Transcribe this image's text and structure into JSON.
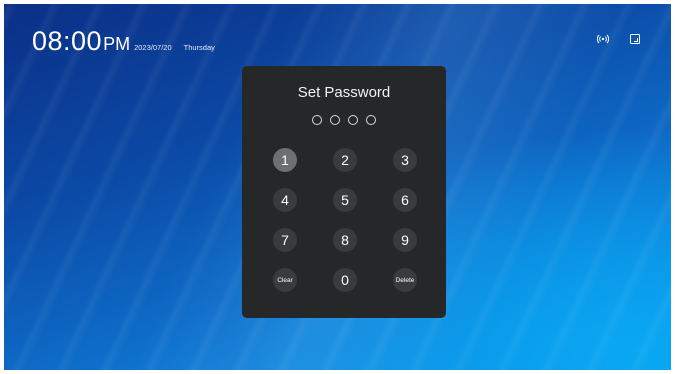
{
  "status_bar": {
    "time": "08:00",
    "ampm": "PM",
    "date": "2023/07/20",
    "day": "Thursday",
    "icons": [
      "signal-icon",
      "input-source-icon"
    ]
  },
  "dialog": {
    "title": "Set Password",
    "pin_length": 4,
    "keys": [
      {
        "label": "1",
        "selected": true
      },
      {
        "label": "2",
        "selected": false
      },
      {
        "label": "3",
        "selected": false
      },
      {
        "label": "4",
        "selected": false
      },
      {
        "label": "5",
        "selected": false
      },
      {
        "label": "6",
        "selected": false
      },
      {
        "label": "7",
        "selected": false
      },
      {
        "label": "8",
        "selected": false
      },
      {
        "label": "9",
        "selected": false
      },
      {
        "label": "Clear",
        "selected": false
      },
      {
        "label": "0",
        "selected": false
      },
      {
        "label": "Delete",
        "selected": false
      }
    ]
  },
  "colors": {
    "dialog_bg": "#262729",
    "key_bg": "#3a3b3e",
    "key_selected_bg": "#6e6f72",
    "wallpaper_accent": "#0aa7f2"
  }
}
